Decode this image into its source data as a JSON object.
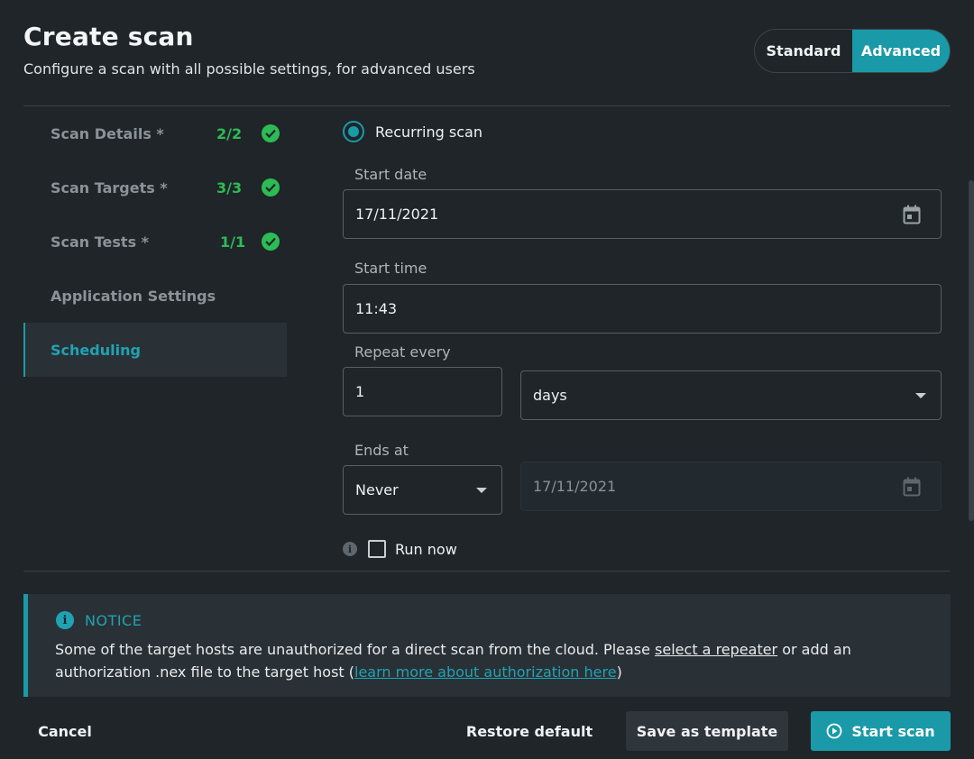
{
  "header": {
    "title": "Create scan",
    "subtitle": "Configure a scan with all possible settings, for advanced users"
  },
  "mode_toggle": {
    "options": [
      "Standard",
      "Advanced"
    ],
    "selected": "Advanced"
  },
  "sidebar": {
    "items": [
      {
        "label": "Scan Details *",
        "count": "2/2",
        "completed": true
      },
      {
        "label": "Scan Targets *",
        "count": "3/3",
        "completed": true
      },
      {
        "label": "Scan Tests *",
        "count": "1/1",
        "completed": true
      },
      {
        "label": "Application Settings",
        "count": "",
        "completed": false
      },
      {
        "label": "Scheduling",
        "count": "",
        "completed": false,
        "active": true
      }
    ]
  },
  "scheduling": {
    "recurring_label": "Recurring scan",
    "start_date_label": "Start date",
    "start_date_value": "17/11/2021",
    "start_time_label": "Start time",
    "start_time_value": "11:43",
    "repeat_label": "Repeat every",
    "repeat_value": "1",
    "repeat_unit": "days",
    "ends_label": "Ends at",
    "ends_value": "Never",
    "ends_date_value": "17/11/2021",
    "run_now_label": "Run now"
  },
  "notice": {
    "title": "NOTICE",
    "text_1": "Some of the target hosts are unauthorized for a direct scan from the cloud. Please ",
    "link_1": "select a repeater",
    "text_2": " or add an authorization .nex file to the target host (",
    "link_2": "learn more about authorization here",
    "text_3": ")"
  },
  "footer": {
    "cancel": "Cancel",
    "restore": "Restore default",
    "save_template": "Save as template",
    "start": "Start scan"
  },
  "colors": {
    "background": "#1f2529",
    "accent": "#1a9aa8",
    "success": "#2dbb55",
    "panel": "#2a3136"
  }
}
